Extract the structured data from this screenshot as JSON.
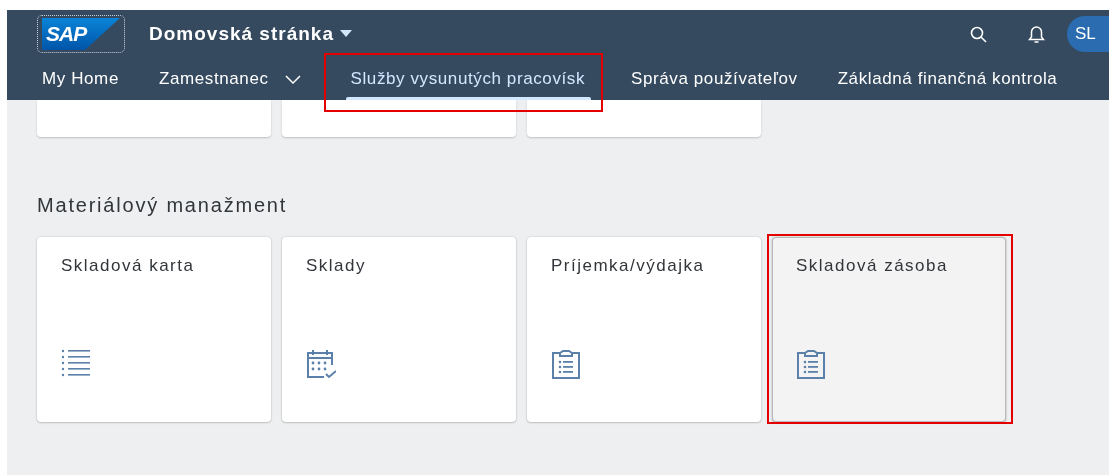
{
  "shell_bar": {
    "logo": "SAP",
    "title": "Domovská stránka",
    "avatar": "SL"
  },
  "nav_tabs": [
    {
      "label": "My Home",
      "selected": false,
      "dropdown": false,
      "highlighted": false
    },
    {
      "label": "Zamestnanec",
      "selected": false,
      "dropdown": true,
      "highlighted": false
    },
    {
      "label": "Služby vysunutých pracovísk",
      "selected": true,
      "dropdown": false,
      "highlighted": true
    },
    {
      "label": "Správa používateľov",
      "selected": false,
      "dropdown": false,
      "highlighted": false
    },
    {
      "label": "Základná finančná kontrola",
      "selected": false,
      "dropdown": false,
      "highlighted": false
    }
  ],
  "partial_tiles": [
    {
      "kind": "tile"
    },
    {
      "kind": "tile"
    },
    {
      "kind": "tile"
    }
  ],
  "section": {
    "title": "Materiálový manažment",
    "tiles": [
      {
        "title": "Skladová karta",
        "kind": "list",
        "hovered": false,
        "highlighted": false
      },
      {
        "title": "Sklady",
        "kind": "calendar",
        "hovered": false,
        "highlighted": false
      },
      {
        "title": "Príjemka/výdajka",
        "kind": "clipboard",
        "hovered": false,
        "highlighted": false
      },
      {
        "title": "Skladová zásoba",
        "kind": "clipboard",
        "hovered": true,
        "highlighted": true
      }
    ]
  }
}
